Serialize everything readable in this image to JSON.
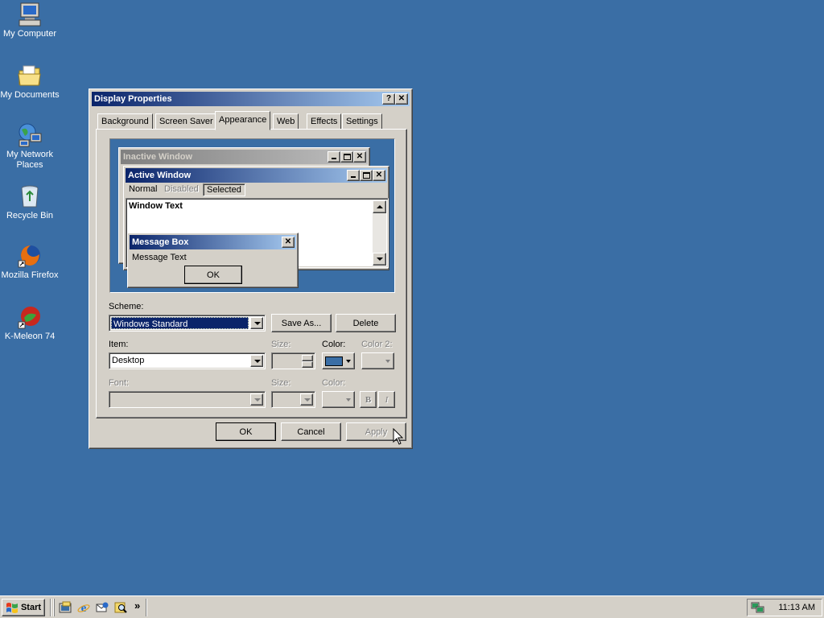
{
  "desktop": {
    "icons": [
      {
        "label": "My Computer"
      },
      {
        "label": "My Documents"
      },
      {
        "label": "My Network Places"
      },
      {
        "label": "Recycle Bin"
      },
      {
        "label": "Mozilla Firefox"
      },
      {
        "label": "K-Meleon 74"
      }
    ],
    "background_color": "#3a6ea5"
  },
  "dialog": {
    "title": "Display Properties",
    "help_button": "?",
    "close_button": "✕",
    "tabs": [
      "Background",
      "Screen Saver",
      "Appearance",
      "Web",
      "Effects",
      "Settings"
    ],
    "active_tab": "Appearance",
    "preview": {
      "inactive_title": "Inactive Window",
      "active_title": "Active Window",
      "menu": {
        "normal": "Normal",
        "disabled": "Disabled",
        "selected": "Selected"
      },
      "window_text": "Window Text",
      "msgbox_title": "Message Box",
      "msgbox_text": "Message Text",
      "msgbox_ok": "OK"
    },
    "scheme": {
      "label": "Scheme:",
      "value": "Windows Standard",
      "save_as": "Save As...",
      "delete": "Delete"
    },
    "item": {
      "label": "Item:",
      "value": "Desktop",
      "size_label": "Size:",
      "color_label": "Color:",
      "color2_label": "Color 2:",
      "color_value": "#3a6ea5"
    },
    "font": {
      "label": "Font:",
      "size_label": "Size:",
      "color_label": "Color:",
      "bold": "B",
      "italic": "I"
    },
    "buttons": {
      "ok": "OK",
      "cancel": "Cancel",
      "apply": "Apply"
    }
  },
  "taskbar": {
    "start_label": "Start",
    "quicklaunch": [
      "show-desktop-icon",
      "internet-explorer-icon",
      "outlook-express-icon",
      "search-icon"
    ],
    "more": "»",
    "clock": "11:13 AM"
  }
}
